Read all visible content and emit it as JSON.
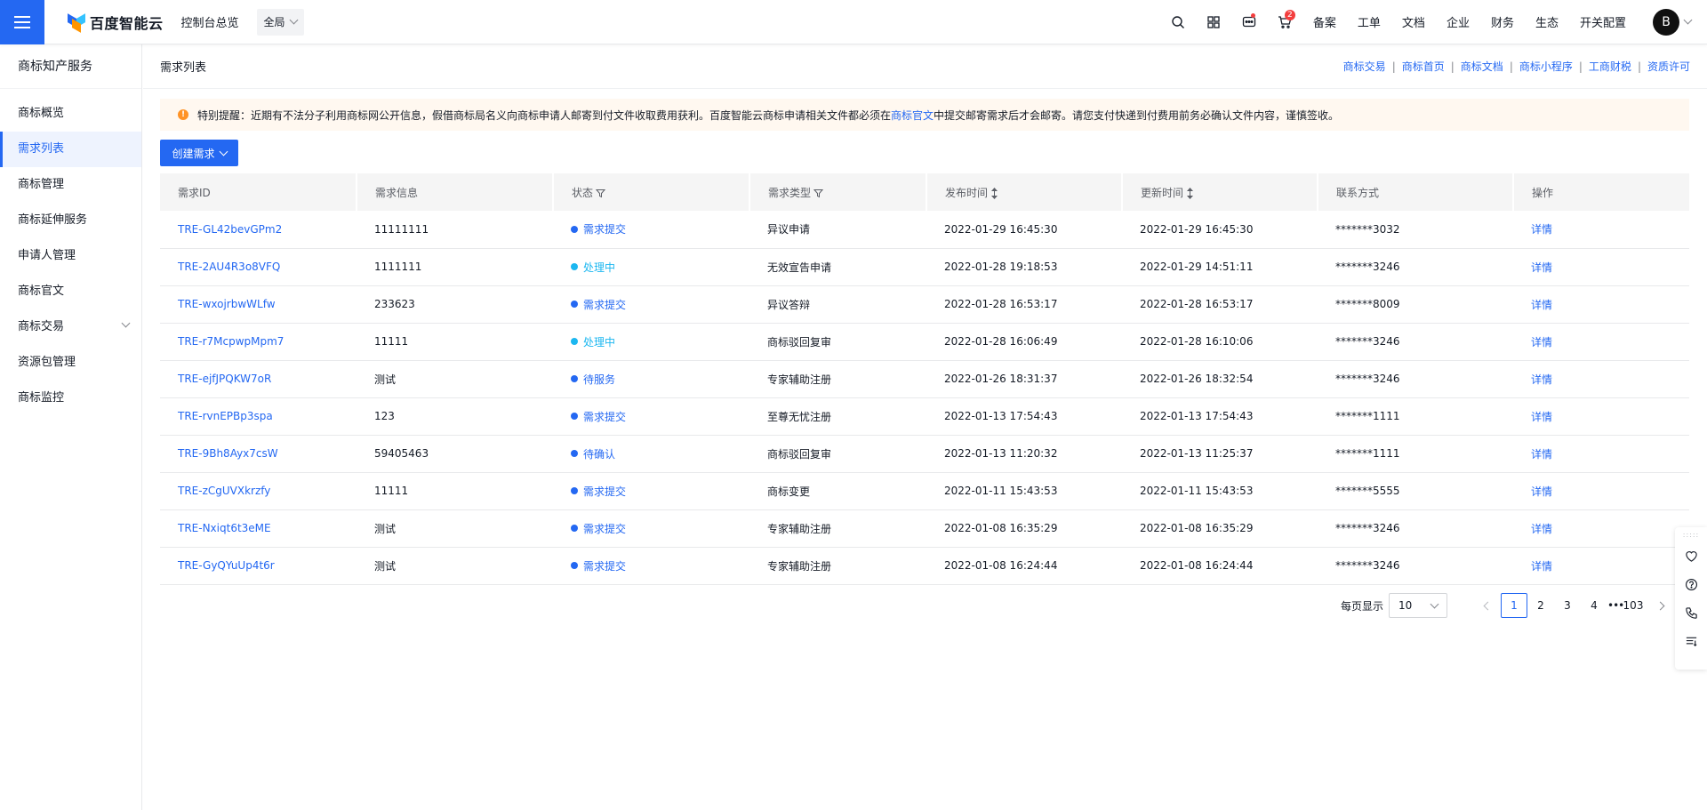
{
  "topbar": {
    "logo_text": "百度智能云",
    "console_link": "控制台总览",
    "region": "全局",
    "cart_badge": "2",
    "nav": [
      "备案",
      "工单",
      "文档",
      "企业",
      "财务",
      "生态",
      "开关配置"
    ],
    "avatar_letter": "B",
    "icons": [
      "search-icon",
      "grid-icon",
      "message-icon",
      "cart-icon"
    ]
  },
  "sidebar": {
    "title": "商标知产服务",
    "items": [
      {
        "label": "商标概览"
      },
      {
        "label": "需求列表"
      },
      {
        "label": "商标管理"
      },
      {
        "label": "商标延伸服务"
      },
      {
        "label": "申请人管理"
      },
      {
        "label": "商标官文"
      },
      {
        "label": "商标交易"
      },
      {
        "label": "资源包管理"
      },
      {
        "label": "商标监控"
      }
    ],
    "active_index": 1
  },
  "page": {
    "title": "需求列表",
    "quick_links": [
      "商标交易",
      "商标首页",
      "商标文档",
      "商标小程序",
      "工商财税",
      "资质许可"
    ],
    "notice": {
      "before": "特别提醒：近期有不法分子利用商标网公开信息，假借商标局名义向商标申请人邮寄到付文件收取费用获利。百度智能云商标申请相关文件都必须在",
      "link": "商标官文",
      "after": "中提交邮寄需求后才会邮寄。请您支付快递到付费用前务必确认文件内容，谨慎签收。"
    },
    "create_button": "创建需求"
  },
  "table": {
    "columns": [
      "需求ID",
      "需求信息",
      "状态",
      "需求类型",
      "发布时间",
      "更新时间",
      "联系方式",
      "操作"
    ],
    "rows": [
      {
        "id": "TRE-GL42bevGPm2",
        "info": "11111111",
        "status": "需求提交",
        "status_kind": "submitted",
        "type": "异议申请",
        "published": "2022-01-29 16:45:30",
        "updated": "2022-01-29 16:45:30",
        "contact": "*******3032",
        "action": "详情"
      },
      {
        "id": "TRE-2AU4R3o8VFQ",
        "info": "1111111",
        "status": "处理中",
        "status_kind": "processing",
        "type": "无效宣告申请",
        "published": "2022-01-28 19:18:53",
        "updated": "2022-01-29 14:51:11",
        "contact": "*******3246",
        "action": "详情"
      },
      {
        "id": "TRE-wxojrbwWLfw",
        "info": "233623",
        "status": "需求提交",
        "status_kind": "submitted",
        "type": "异议答辩",
        "published": "2022-01-28 16:53:17",
        "updated": "2022-01-28 16:53:17",
        "contact": "*******8009",
        "action": "详情"
      },
      {
        "id": "TRE-r7McpwpMpm7",
        "info": "11111",
        "status": "处理中",
        "status_kind": "processing",
        "type": "商标驳回复审",
        "published": "2022-01-28 16:06:49",
        "updated": "2022-01-28 16:10:06",
        "contact": "*******3246",
        "action": "详情"
      },
      {
        "id": "TRE-ejfJPQKW7oR",
        "info": "测试",
        "status": "待服务",
        "status_kind": "submitted",
        "type": "专家辅助注册",
        "published": "2022-01-26 18:31:37",
        "updated": "2022-01-26 18:32:54",
        "contact": "*******3246",
        "action": "详情"
      },
      {
        "id": "TRE-rvnEPBp3spa",
        "info": "123",
        "status": "需求提交",
        "status_kind": "submitted",
        "type": "至尊无忧注册",
        "published": "2022-01-13 17:54:43",
        "updated": "2022-01-13 17:54:43",
        "contact": "*******1111",
        "action": "详情"
      },
      {
        "id": "TRE-9Bh8Ayx7csW",
        "info": "59405463",
        "status": "待确认",
        "status_kind": "submitted",
        "type": "商标驳回复审",
        "published": "2022-01-13 11:20:32",
        "updated": "2022-01-13 11:25:37",
        "contact": "*******1111",
        "action": "详情"
      },
      {
        "id": "TRE-zCgUVXkrzfy",
        "info": "11111",
        "status": "需求提交",
        "status_kind": "submitted",
        "type": "商标变更",
        "published": "2022-01-11 15:43:53",
        "updated": "2022-01-11 15:43:53",
        "contact": "*******5555",
        "action": "详情"
      },
      {
        "id": "TRE-Nxiqt6t3eME",
        "info": "测试",
        "status": "需求提交",
        "status_kind": "submitted",
        "type": "专家辅助注册",
        "published": "2022-01-08 16:35:29",
        "updated": "2022-01-08 16:35:29",
        "contact": "*******3246",
        "action": "详情"
      },
      {
        "id": "TRE-GyQYuUp4t6r",
        "info": "测试",
        "status": "需求提交",
        "status_kind": "submitted",
        "type": "专家辅助注册",
        "published": "2022-01-08 16:24:44",
        "updated": "2022-01-08 16:24:44",
        "contact": "*******3246",
        "action": "详情"
      }
    ]
  },
  "pagination": {
    "page_size_label": "每页显示",
    "page_size": "10",
    "pages": [
      "1",
      "2",
      "3",
      "4"
    ],
    "current": "1",
    "ellipsis": "•••",
    "last": "103"
  },
  "colors": {
    "primary": "#2468f2",
    "processing": "#1cb7f0",
    "warning": "#ff9326",
    "notice_bg": "#fff8f0"
  }
}
